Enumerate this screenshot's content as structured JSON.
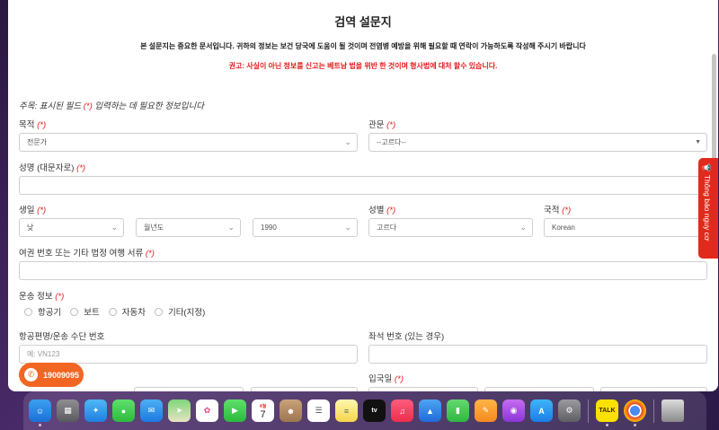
{
  "form": {
    "title": "검역 설문지",
    "notice": "본 설문지는 중요한 문서입니다. 귀하의 정보는 보건 당국에 도움이 될 것이며 전염병 예방을 위해 필요할 때 연락이 가능하도록 작성해 주시기 바랍니다",
    "warning": "권고: 사실이 아닌 정보를 신고는 베트남 법을 위반 한 것이며 형사법에 대처 할수 있습니다.",
    "note_prefix": "주목: 표시된 필드",
    "note_req": "(*)",
    "note_suffix": "입력하는 데 필요한 정보입니다",
    "required_mark": "(*)",
    "labels": {
      "purpose": "목적",
      "gate": "관문",
      "full_name": "성명 (대문자로)",
      "birth": "생일",
      "gender": "성별",
      "nationality": "국적",
      "passport": "여권 번호 또는 기타 법정 여행 서류",
      "transport": "운송 정보",
      "flight": "항공편명/운송 수단 번호",
      "seat": "좌석 번호 (있는 경우)",
      "entry_date": "입국일"
    },
    "values": {
      "purpose": "전문가",
      "gate": "--고르다--",
      "birth_day": "낮",
      "birth_month": "월년도",
      "birth_year": "1990",
      "gender": "고르다",
      "nationality": "Korean",
      "full_name": "",
      "passport": "",
      "seat": ""
    },
    "placeholders": {
      "flight": "예: VN123"
    },
    "transport_options": [
      "항공기",
      "보트",
      "자동차",
      "기타(지정)"
    ]
  },
  "widgets": {
    "report_tab": "Thông báo nguy cơ",
    "hotline": "19009095"
  },
  "dock": {
    "calendar_month": "4월",
    "calendar_day": "7",
    "talk_label": "TALK"
  }
}
